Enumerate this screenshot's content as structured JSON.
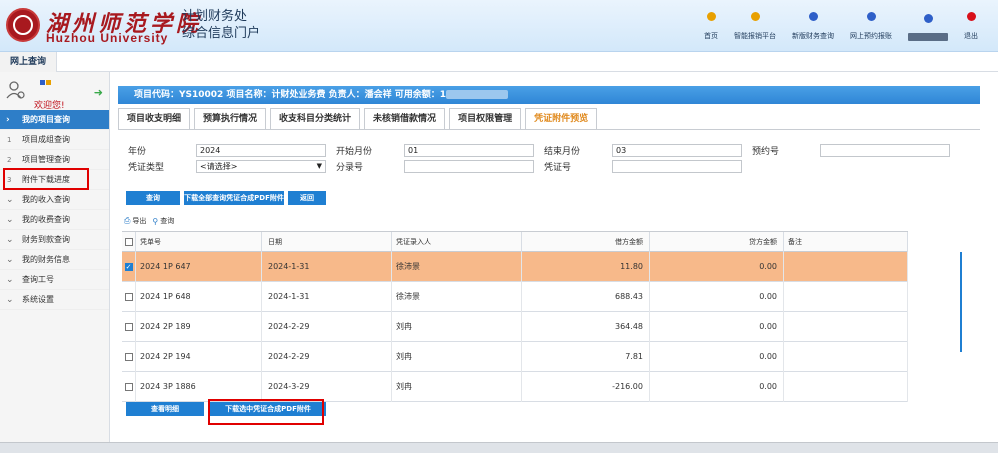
{
  "header": {
    "logo_cn": "湖州师范学院",
    "logo_en": "Huzhou University",
    "portal_title_line1": "计划财务处",
    "portal_title_line2": "综合信息门户",
    "nav": [
      {
        "label": "首页",
        "color": "#e8a000"
      },
      {
        "label": "智能报销平台",
        "color": "#e8a000"
      },
      {
        "label": "新版财务查询",
        "color": "#2e5fc8"
      },
      {
        "label": "网上预约报账",
        "color": "#2e5fc8"
      },
      {
        "label": "退出",
        "color": "#d8101a"
      }
    ]
  },
  "breadcrumb": "网上查询",
  "sidebar": {
    "welcome": "欢迎您!",
    "items": [
      {
        "label": "我的项目查询",
        "type": "group-active"
      },
      {
        "num": "1",
        "label": "项目成组查询"
      },
      {
        "num": "2",
        "label": "项目管理查询"
      },
      {
        "num": "3",
        "label": "附件下载进度"
      },
      {
        "label": "我的收入查询",
        "type": "group"
      },
      {
        "label": "我的收费查询",
        "type": "group"
      },
      {
        "label": "财务到款查询",
        "type": "group"
      },
      {
        "label": "我的财务信息",
        "type": "group"
      },
      {
        "label": "查询工号",
        "type": "group"
      },
      {
        "label": "系统设置",
        "type": "group"
      }
    ]
  },
  "project_bar": "项目代码：YS10002 项目名称：计财处业务费 负责人：潘会祥 可用余额：1",
  "tabs": [
    "项目收支明细",
    "预算执行情况",
    "收支科目分类统计",
    "未核销借款情况",
    "项目权限管理",
    "凭证附件预览"
  ],
  "active_tab": 5,
  "form": {
    "year_label": "年份",
    "year_value": "2024",
    "start_month_label": "开始月份",
    "start_month_value": "01",
    "end_month_label": "结束月份",
    "end_month_value": "03",
    "reserve_label": "预约号",
    "reserve_value": "",
    "voucher_type_label": "凭证类型",
    "voucher_type_value": "<请选择>",
    "entry_no_label": "分录号",
    "entry_no_value": "",
    "voucher_no_label": "凭证号",
    "voucher_no_value": ""
  },
  "buttons": {
    "query": "查询",
    "download_all": "下载全部查询凭证合成PDF附件",
    "back": "返回",
    "export": "导出",
    "search": "查询",
    "view_detail": "查看明细",
    "download_selected": "下载选中凭证合成PDF附件"
  },
  "table": {
    "headers": [
      "凭单号",
      "日期",
      "凭证录入人",
      "借方金额",
      "贷方金额",
      "备注"
    ],
    "rows": [
      {
        "no": "2024 1P  647",
        "date": "2024-1-31",
        "maker": "徐沛景",
        "debit": "11.80",
        "credit": "0.00",
        "note": "",
        "checked": true
      },
      {
        "no": "2024 1P  648",
        "date": "2024-1-31",
        "maker": "徐沛景",
        "debit": "688.43",
        "credit": "0.00",
        "note": "",
        "checked": false
      },
      {
        "no": "2024 2P  189",
        "date": "2024-2-29",
        "maker": "刘冉",
        "debit": "364.48",
        "credit": "0.00",
        "note": "",
        "checked": false
      },
      {
        "no": "2024 2P  194",
        "date": "2024-2-29",
        "maker": "刘冉",
        "debit": "7.81",
        "credit": "0.00",
        "note": "",
        "checked": false
      },
      {
        "no": "2024 3P  1886",
        "date": "2024-3-29",
        "maker": "刘冉",
        "debit": "-216.00",
        "credit": "0.00",
        "note": "",
        "checked": false
      }
    ]
  },
  "colors": {
    "accent": "#2e7ec8",
    "selected_row": "#f7b98a",
    "highlight": "#e00000",
    "brand": "#a8191f"
  }
}
